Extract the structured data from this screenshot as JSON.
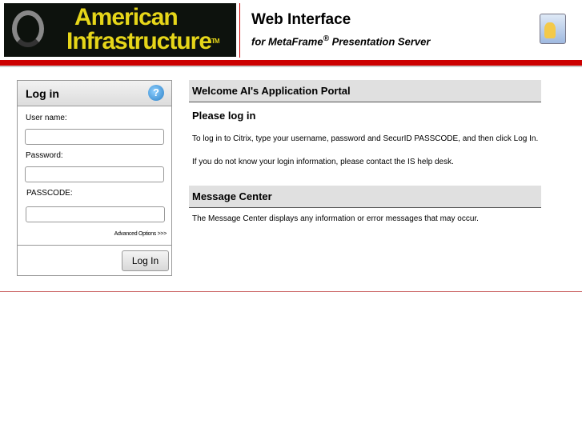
{
  "header": {
    "logo_line1": "American",
    "logo_line2": "Infrastructure",
    "logo_tm": "TM",
    "title": "Web Interface",
    "subtitle_pre": "for MetaFrame",
    "subtitle_reg": "®",
    "subtitle_post": " Presentation Server"
  },
  "login": {
    "title": "Log in",
    "username_label": "User name:",
    "password_label": "Password:",
    "passcode_label": "PASSCODE:",
    "advanced": "Advanced Options >>>",
    "button": "Log In",
    "help_glyph": "?"
  },
  "main": {
    "welcome": "Welcome AI's Application Portal",
    "please": "Please log in",
    "instr": "To log in to Citrix, type your username, password and SecurID PASSCODE, and then click Log In.",
    "help": "If you do not know your login information, please contact the IS help desk.",
    "mc_title": "Message Center",
    "mc_text": "The Message Center displays any information or error messages that may occur."
  },
  "colors": {
    "accent": "#cc0000",
    "logo_text": "#e6d619"
  }
}
